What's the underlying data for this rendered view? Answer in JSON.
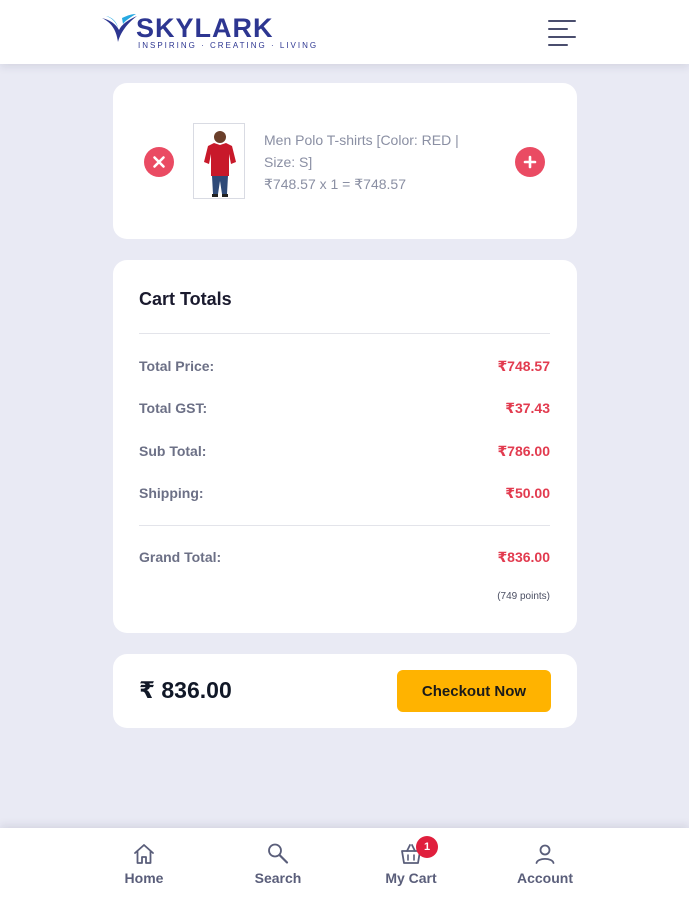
{
  "header": {
    "brand": "SKYLARK",
    "tagline": "INSPIRING · CREATING · LIVING",
    "menu_icon": "hamburger-menu-icon"
  },
  "cart_item": {
    "name": "Men Polo T-shirts [Color: RED | Size: S]",
    "price_line": "₹748.57 x 1 = ₹748.57",
    "remove_icon": "close-icon",
    "add_icon": "plus-icon"
  },
  "cart_totals": {
    "title": "Cart Totals",
    "rows": [
      {
        "label": "Total Price:",
        "value": "₹748.57"
      },
      {
        "label": "Total GST:",
        "value": "₹37.43"
      },
      {
        "label": "Sub Total:",
        "value": "₹786.00"
      },
      {
        "label": "Shipping:",
        "value": "₹50.00"
      }
    ],
    "grand_total": {
      "label": "Grand Total:",
      "value": "₹836.00"
    },
    "points": "(749 points)"
  },
  "checkout": {
    "total": "₹ 836.00",
    "button_label": "Checkout Now"
  },
  "bottom_nav": {
    "items": [
      {
        "label": "Home",
        "icon": "home-icon"
      },
      {
        "label": "Search",
        "icon": "search-icon"
      },
      {
        "label": "My Cart",
        "icon": "cart-icon",
        "badge": "1"
      },
      {
        "label": "Account",
        "icon": "user-icon"
      }
    ]
  },
  "colors": {
    "brand": "#2d3691",
    "accent_red": "#e23b4f",
    "checkout_yellow": "#ffb300",
    "background": "#e9eaf4"
  }
}
